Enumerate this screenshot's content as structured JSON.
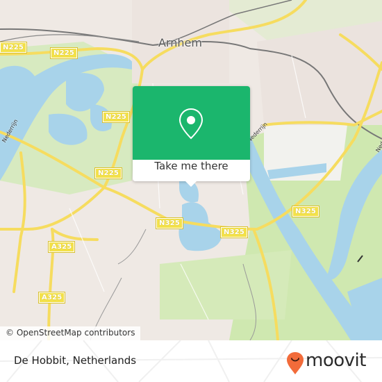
{
  "map": {
    "city_label": "Arnhem",
    "river_labels": [
      "Nederrijn",
      "Nederrijn",
      "Nederrijn"
    ],
    "road_labels": [
      "N225",
      "N225",
      "N225",
      "N225",
      "N325",
      "N325",
      "N325",
      "A325",
      "A325"
    ],
    "attribution": "© OpenStreetMap contributors",
    "colors": {
      "water": "#a8d3ea",
      "green": "#cfe8b0",
      "land": "#efe9e4",
      "road": "#f6dc5f",
      "rail": "#777777"
    }
  },
  "popup": {
    "button_label": "Take me there",
    "icon": "map-pin-icon",
    "color": "#1bb66d"
  },
  "footer": {
    "place_name": "De Hobbit, Netherlands",
    "brand": "moovit",
    "brand_color": "#f26b3a"
  }
}
